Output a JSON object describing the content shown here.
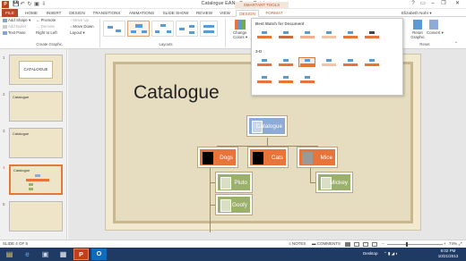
{
  "window": {
    "title": "Catalogue EAN - PowerPoint",
    "contextual_header": "SMARTART TOOLS",
    "minimize": "–",
    "restore": "❐",
    "close": "✕",
    "help": "?",
    "ribbon_display": "▭",
    "app_icon": "P"
  },
  "qat": {
    "save": "💾",
    "undo": "↶",
    "redo": "↻",
    "start": "▣",
    "customize": "⇩"
  },
  "tabs": [
    "FILE",
    "HOME",
    "INSERT",
    "DESIGN",
    "TRANSITIONS",
    "ANIMATIONS",
    "SLIDE SHOW",
    "REVIEW",
    "VIEW",
    "DESIGN",
    "FORMAT"
  ],
  "user": "Elizabeth Nohr ▾",
  "ribbon": {
    "create_graphic": {
      "add_shape": "Add Shape ▾",
      "add_bullet": "Add Bullet",
      "text_pane": "Text Pane",
      "promote": "← Promote",
      "demote": "→ Demote",
      "right_to_left": "Right to Left",
      "move_up": "↑ Move Up",
      "move_down": "↓ Move Down",
      "layout": "Layout ▾",
      "label": "Create Graphic"
    },
    "layouts_label": "Layouts",
    "change_colors": "Change Colors ▾",
    "reset_graphic": "Reset Graphic",
    "convert": "Convert ▾",
    "reset_label": "Reset"
  },
  "dropdown": {
    "best_match": "Best Match for Document",
    "three_d": "3-D"
  },
  "slides": [
    {
      "number": "1",
      "title": "CATALOGUE"
    },
    {
      "number": "2",
      "title": "Catalogue"
    },
    {
      "number": "3",
      "title": "Catalogue"
    },
    {
      "number": "4",
      "title": "Catalogue"
    },
    {
      "number": "5",
      "title": ""
    }
  ],
  "slide": {
    "title": "Catalogue",
    "nodes": {
      "root": "Catalogue",
      "dogs": "Dogs",
      "cats": "Cats",
      "mice": "Mice",
      "pluto": "Pluto",
      "goofy": "Goofy",
      "mickey": "Mickey"
    }
  },
  "status": {
    "slide_indicator": "SLIDE 4 OF 5",
    "notes": "≡ NOTES",
    "comments": "▬ COMMENTS",
    "zoom_minus": "−",
    "zoom_plus": "+",
    "zoom": "74%",
    "fit": "⤢"
  },
  "zoom_level_pct": 74,
  "taskbar": {
    "desktop": "Desktop",
    "time": "6:02 PM",
    "date": "10/21/2013"
  },
  "colors": {
    "accent": "#b65a2a",
    "file_tab": "#b7472a",
    "node_orange": "#e8743a",
    "node_blue": "#8eaad6",
    "node_green": "#9bb06a",
    "slide_bg": "#e6dcbf",
    "taskbar": "#1f3a63"
  }
}
